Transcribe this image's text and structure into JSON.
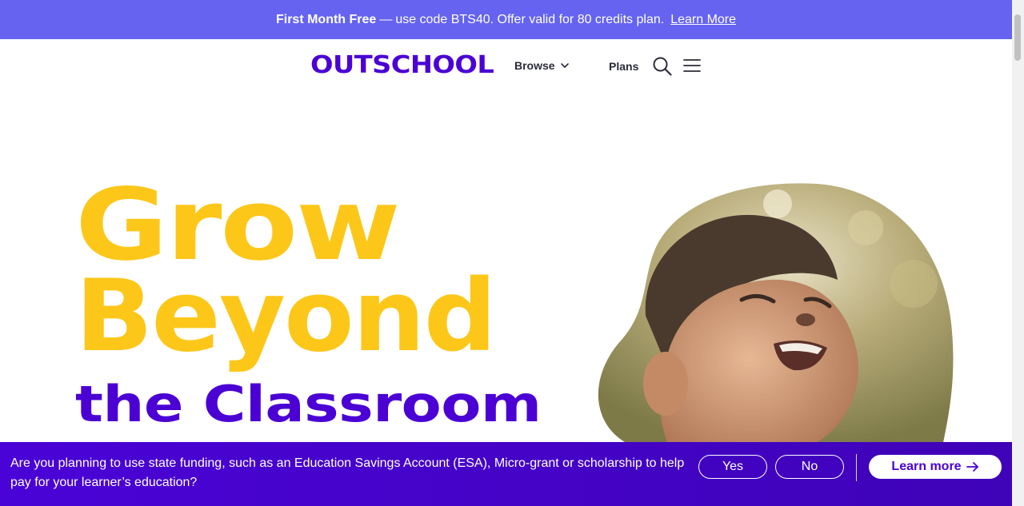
{
  "promo": {
    "strong": "First Month Free",
    "separator": "—",
    "text": "use code BTS40. Offer valid for 80 credits plan.",
    "link": "Learn More"
  },
  "header": {
    "logo": "OUTSCHOOL",
    "nav": {
      "browse": "Browse",
      "plans": "Plans"
    },
    "icons": {
      "search": "search-icon",
      "menu": "menu-icon",
      "browse_chevron": "chevron-down-icon"
    }
  },
  "hero": {
    "line1": "Grow",
    "line2": "Beyond",
    "line3": "the Classroom",
    "image": "smiling-child-photo"
  },
  "funding": {
    "question": "Are you planning to use state funding, such as an Education Savings Account (ESA), Micro-grant or scholarship to help pay for your learner’s education?",
    "yes": "Yes",
    "no": "No",
    "learn_more": "Learn more"
  },
  "colors": {
    "brand_purple": "#4b01d4",
    "promo_bg": "#6563f0",
    "hero_yellow": "#fdc71a"
  }
}
